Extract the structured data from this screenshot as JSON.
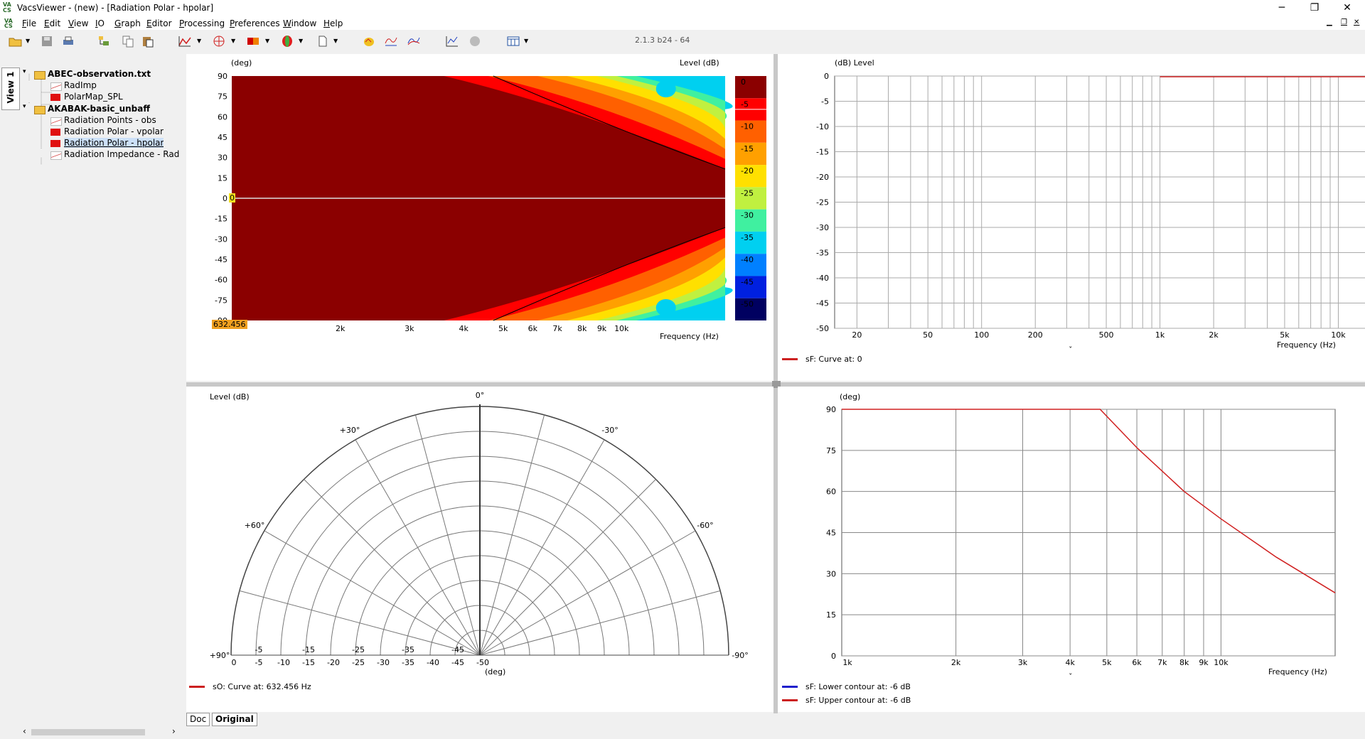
{
  "window": {
    "title": "VacsViewer - (new) - [Radiation Polar - hpolar]",
    "min": "─",
    "restore": "❐",
    "close": "✕"
  },
  "menu": [
    "File",
    "Edit",
    "View",
    "IO",
    "Graph",
    "Editor",
    "Processing",
    "Preferences",
    "Window",
    "Help"
  ],
  "version": "2.1.3 b24 - 64",
  "view_tab": "View 1",
  "tree": [
    {
      "label": "ABEC-observation.txt",
      "bold": true,
      "level": 0,
      "icon": "folder-icon"
    },
    {
      "label": "RadImp",
      "bold": false,
      "level": 1,
      "icon": "line-graph-icon"
    },
    {
      "label": "PolarMap_SPL",
      "bold": false,
      "level": 1,
      "icon": "colormap-icon"
    },
    {
      "label": "AKABAK-basic_unbaff",
      "bold": true,
      "level": 0,
      "icon": "folder-icon"
    },
    {
      "label": "Radiation Points - obs",
      "bold": false,
      "level": 1,
      "icon": "line-graph-icon"
    },
    {
      "label": "Radiation Polar - vpolar",
      "bold": false,
      "level": 1,
      "icon": "colormap-icon"
    },
    {
      "label": "Radiation Polar - hpolar",
      "bold": false,
      "level": 1,
      "icon": "colormap-icon",
      "selected": true
    },
    {
      "label": "Radiation Impedance - Rad",
      "bold": false,
      "level": 1,
      "icon": "line-graph-icon"
    }
  ],
  "polarmap": {
    "y_unit": "(deg)",
    "level_unit": "Level  (dB)",
    "x_unit": "Frequency  (Hz)",
    "y_ticks": [
      "90",
      "75",
      "60",
      "45",
      "30",
      "15",
      "0",
      "-15",
      "-30",
      "-45",
      "-60",
      "-75",
      "-90"
    ],
    "x_ticks": [
      "2k",
      "3k",
      "4k",
      "5k",
      "6k",
      "7k",
      "8k",
      "9k",
      "10k"
    ],
    "cursor_freq": "632.456",
    "cursor_angle": "0",
    "colorbar_ticks": [
      "0",
      "-5",
      "-10",
      "-15",
      "-20",
      "-25",
      "-30",
      "-35",
      "-40",
      "-45",
      "-50"
    ],
    "colorbar_colors": [
      "#8b0000",
      "#ff0000",
      "#ff6000",
      "#ffa000",
      "#ffe000",
      "#c0f040",
      "#40f0a0",
      "#00d0f0",
      "#0080ff",
      "#0020e0",
      "#000060"
    ]
  },
  "freqresp": {
    "y_unit": "(dB)  Level",
    "x_unit": "Frequency  (Hz)",
    "y_ticks": [
      "0",
      "-5",
      "-10",
      "-15",
      "-20",
      "-25",
      "-30",
      "-35",
      "-40",
      "-45",
      "-50"
    ],
    "x_ticks": [
      "20",
      "50",
      "100",
      "200",
      "500",
      "1k",
      "2k",
      "5k",
      "10k"
    ],
    "legend": [
      {
        "label": "sF: Curve at: 0",
        "color": "#cc2020"
      }
    ],
    "chevron": "ˇ"
  },
  "polar": {
    "level_unit": "Level  (dB)",
    "deg_unit": "(deg)",
    "angle_labels": [
      "0°",
      "+30°",
      "-30°",
      "+60°",
      "-60°",
      "+90°",
      "-90°"
    ],
    "radial_ticks": [
      "0",
      "-5",
      "-10",
      "-15",
      "-20",
      "-25",
      "-30",
      "-35",
      "-40",
      "-45",
      "-50"
    ],
    "legend": [
      {
        "label": "sO: Curve at: 632.456 Hz",
        "color": "#cc2020"
      }
    ]
  },
  "beamwidth": {
    "y_unit": "(deg)",
    "x_unit": "Frequency  (Hz)",
    "y_ticks": [
      "90",
      "75",
      "60",
      "45",
      "30",
      "15",
      "0"
    ],
    "x_ticks": [
      "1k",
      "2k",
      "3k",
      "4k",
      "5k",
      "6k",
      "7k",
      "8k",
      "9k",
      "10k"
    ],
    "legend": [
      {
        "label": "sF: Lower contour at: -6 dB",
        "color": "#2020cc"
      },
      {
        "label": "sF: Upper contour at: -6 dB",
        "color": "#cc2020"
      }
    ],
    "chevron": "ˇ"
  },
  "doc_tabs": [
    "Doc",
    "Original"
  ]
}
